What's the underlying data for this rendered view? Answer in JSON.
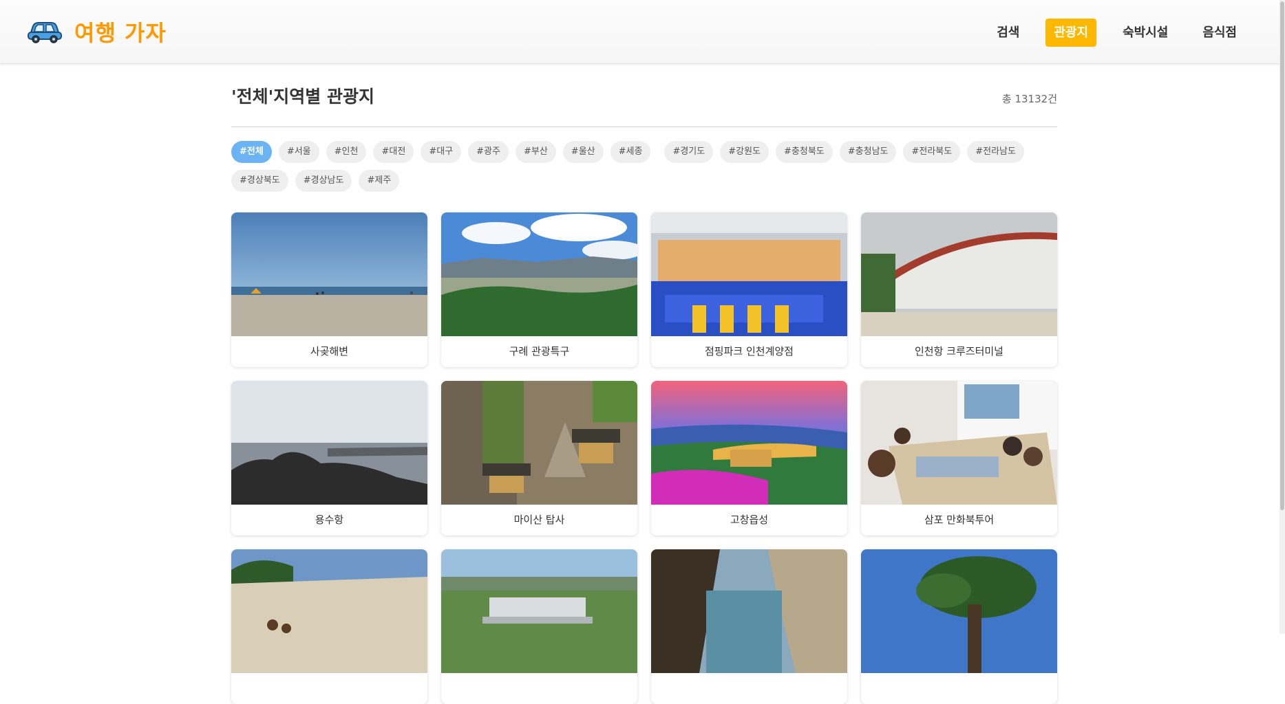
{
  "header": {
    "logo_icon": "car-icon",
    "logo_text": "여행 가자",
    "nav": [
      {
        "label": "검색",
        "active": false
      },
      {
        "label": "관광지",
        "active": true
      },
      {
        "label": "숙박시설",
        "active": false
      },
      {
        "label": "음식점",
        "active": false
      }
    ]
  },
  "main": {
    "title": "'전체'지역별 관광지",
    "count": "총 13132건",
    "tags": [
      "#전체",
      "#서울",
      "#인천",
      "#대전",
      "#대구",
      "#광주",
      "#부산",
      "#울산",
      "#세종",
      "#경기도",
      "#강원도",
      "#충청북도",
      "#충청남도",
      "#전라북도",
      "#전라남도",
      "#경상북도",
      "#경상남도",
      "#제주"
    ],
    "active_tag": "#전체",
    "cards": [
      {
        "name": "사곶해변"
      },
      {
        "name": "구례 관광특구"
      },
      {
        "name": "점핑파크 인천계양점"
      },
      {
        "name": "인천항 크루즈터미널"
      },
      {
        "name": "용수항"
      },
      {
        "name": "마이산 탑사"
      },
      {
        "name": "고창읍성"
      },
      {
        "name": "삼포 만화북투어"
      },
      {
        "name": ""
      },
      {
        "name": ""
      },
      {
        "name": ""
      },
      {
        "name": ""
      }
    ]
  },
  "colors": {
    "brand": "#ff9900",
    "nav_active": "#ffb800",
    "tag_active": "#6bb3f2"
  }
}
